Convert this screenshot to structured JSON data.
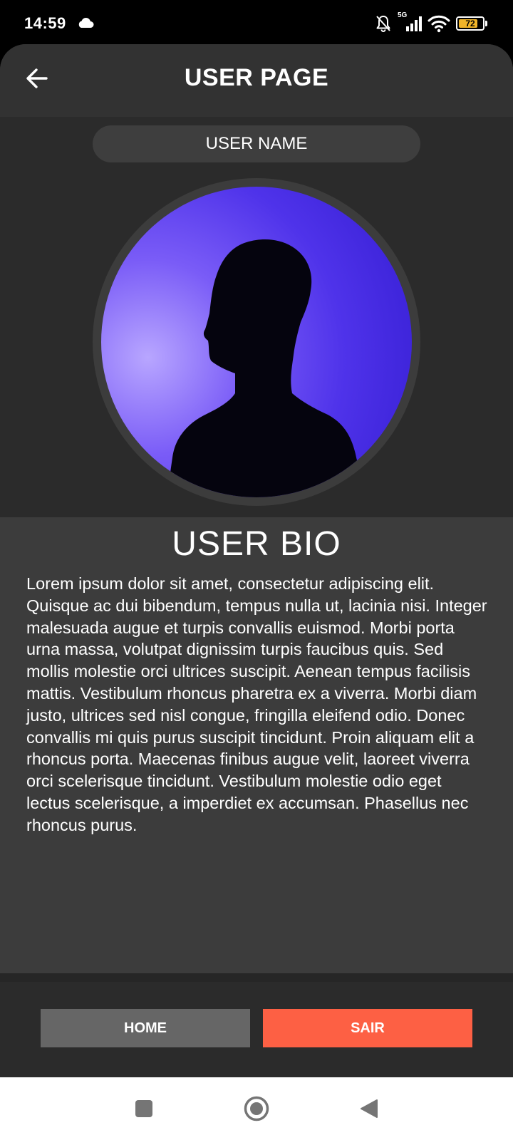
{
  "status_bar": {
    "time": "14:59",
    "network": "5G",
    "battery": "72",
    "battery_level": 0.72,
    "icons": [
      "cloud-icon",
      "notifications-off-icon",
      "signal-icon",
      "wifi-icon",
      "battery-icon"
    ]
  },
  "header": {
    "title": "USER PAGE",
    "back_icon": "arrow-left-icon"
  },
  "user": {
    "name": "USER NAME",
    "avatar": "profile-photo"
  },
  "bio": {
    "title": "USER BIO",
    "text": "Lorem ipsum dolor sit amet, consectetur adipiscing elit. Quisque ac dui bibendum, tempus nulla ut, lacinia nisi. Integer malesuada augue et turpis convallis euismod. Morbi porta urna massa, volutpat dignissim turpis faucibus quis. Sed mollis molestie orci ultrices suscipit. Aenean tempus facilisis mattis. Vestibulum rhoncus pharetra ex a viverra. Morbi diam justo, ultrices sed nisl congue, fringilla eleifend odio. Donec convallis mi quis purus suscipit tincidunt. Proin aliquam elit a rhoncus porta. Maecenas finibus augue velit, laoreet viverra orci scelerisque tincidunt. Vestibulum molestie odio eget lectus scelerisque, a imperdiet ex accumsan. Phasellus nec rhoncus purus."
  },
  "actions": {
    "home_label": "HOME",
    "sair_label": "SAIR"
  },
  "colors": {
    "background": "#2b2b2b",
    "panel": "#3c3c3c",
    "home_button": "#666666",
    "sair_button": "#fd6044",
    "avatar_glow": "#5b3cf0"
  },
  "nav_bar": {
    "icons": [
      "recent-apps-icon",
      "home-circle-icon",
      "back-triangle-icon"
    ]
  }
}
